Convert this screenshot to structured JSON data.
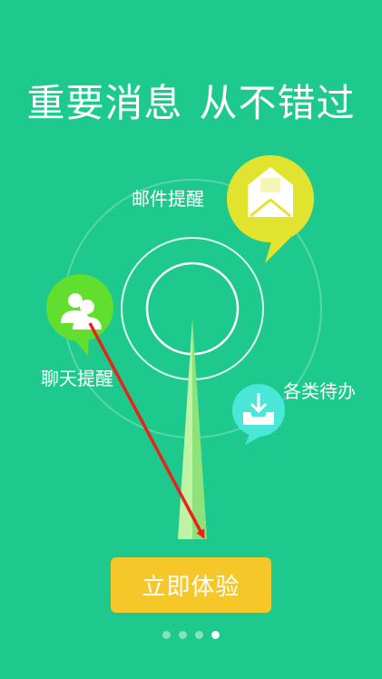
{
  "headline": {
    "part1": "重要消息",
    "part2": "从不错过"
  },
  "features": {
    "email": {
      "label": "邮件提醒",
      "icon": "envelope-open-icon",
      "color": "#e2e32f"
    },
    "chat": {
      "label": "聊天提醒",
      "icon": "two-people-icon",
      "color": "#62df2e"
    },
    "todo": {
      "label": "各类待办",
      "icon": "inbox-download-icon",
      "color": "#49e6d9"
    }
  },
  "cta": {
    "label": "立即体验",
    "color": "#f5c728"
  },
  "pager": {
    "pages": 4,
    "active_index": 3
  },
  "colors": {
    "background": "#1ec98d"
  }
}
